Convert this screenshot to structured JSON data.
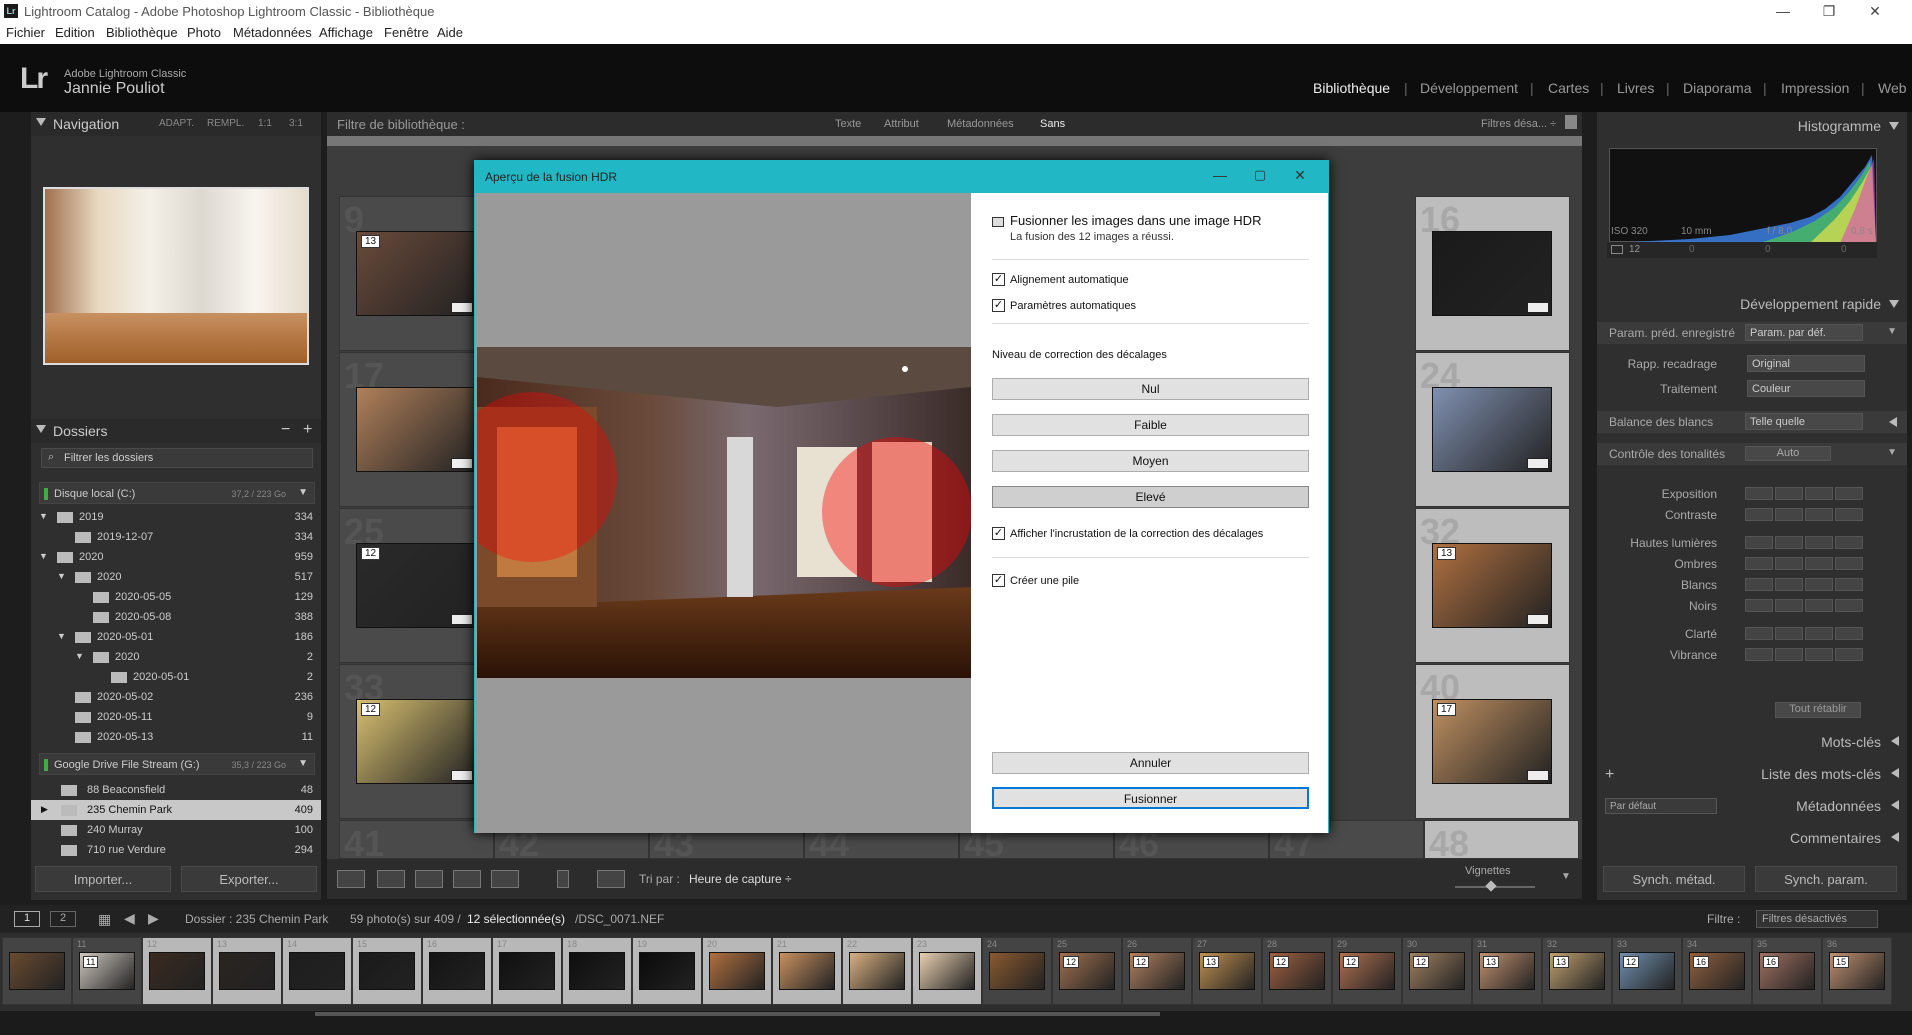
{
  "window": {
    "title": "Lightroom Catalog - Adobe Photoshop Lightroom Classic - Bibliothèque",
    "minimize": "—",
    "restore": "❐",
    "close": "✕",
    "app_icon": "Lr"
  },
  "menu": [
    "Fichier",
    "Edition",
    "Bibliothèque",
    "Photo",
    "Métadonnées",
    "Affichage",
    "Fenêtre",
    "Aide"
  ],
  "identity": {
    "logo": "Lr",
    "app": "Adobe Lightroom Classic",
    "user": "Jannie Pouliot"
  },
  "modules": [
    {
      "label": "Bibliothèque",
      "active": true
    },
    {
      "label": "Développement"
    },
    {
      "label": "Cartes"
    },
    {
      "label": "Livres"
    },
    {
      "label": "Diaporama"
    },
    {
      "label": "Impression"
    },
    {
      "label": "Web"
    }
  ],
  "module_sep": "|",
  "navigator": {
    "title": "Navigation",
    "zoom": [
      "ADAPT.",
      "REMPL.",
      "1:1",
      "3:1"
    ]
  },
  "folders": {
    "title": "Dossiers",
    "minus": "−",
    "plus": "+",
    "filter_placeholder": "Filtrer les dossiers",
    "volumes": [
      {
        "name": "Disque local (C:)",
        "size": "37,2 / 223 Go"
      },
      {
        "name": "Google Drive File Stream (G:)",
        "size": "35,3 / 223 Go"
      }
    ],
    "tree": [
      {
        "name": "2019",
        "count": "334",
        "level": 0,
        "expanded": true
      },
      {
        "name": "2019-12-07",
        "count": "334",
        "level": 1
      },
      {
        "name": "2020",
        "count": "959",
        "level": 0,
        "expanded": true
      },
      {
        "name": "2020",
        "count": "517",
        "level": 1,
        "expanded": true
      },
      {
        "name": "2020-05-05",
        "count": "129",
        "level": 2
      },
      {
        "name": "2020-05-08",
        "count": "388",
        "level": 2
      },
      {
        "name": "2020-05-01",
        "count": "186",
        "level": 1,
        "expanded": true
      },
      {
        "name": "2020",
        "count": "2",
        "level": 2,
        "expanded": true
      },
      {
        "name": "2020-05-01",
        "count": "2",
        "level": 3
      },
      {
        "name": "2020-05-02",
        "count": "236",
        "level": 1
      },
      {
        "name": "2020-05-11",
        "count": "9",
        "level": 1
      },
      {
        "name": "2020-05-13",
        "count": "11",
        "level": 1
      }
    ],
    "gdrive": [
      {
        "name": "88 Beaconsfield",
        "count": "48"
      },
      {
        "name": "235 Chemin Park",
        "count": "409",
        "selected": true
      },
      {
        "name": "240 Murray",
        "count": "100"
      },
      {
        "name": "710 rue Verdure",
        "count": "294"
      }
    ]
  },
  "left_buttons": {
    "import": "Importer...",
    "export": "Exporter..."
  },
  "library_filter": {
    "title": "Filtre de bibliothèque :",
    "tabs": [
      "Texte",
      "Attribut",
      "Métadonnées",
      "Sans"
    ],
    "preset": "Filtres désa... ÷"
  },
  "grid": {
    "cells": [
      {
        "num": "9",
        "badge": "13",
        "row": 0,
        "col": 0
      },
      {
        "num": "16",
        "badge": "",
        "row": 0,
        "col": 7
      },
      {
        "num": "17",
        "badge": "",
        "row": 1,
        "col": 0
      },
      {
        "num": "24",
        "badge": "",
        "row": 1,
        "col": 7
      },
      {
        "num": "25",
        "badge": "12",
        "row": 2,
        "col": 0
      },
      {
        "num": "32",
        "badge": "13",
        "row": 2,
        "col": 7
      },
      {
        "num": "33",
        "badge": "12",
        "row": 3,
        "col": 0
      },
      {
        "num": "40",
        "badge": "17",
        "row": 3,
        "col": 7
      }
    ],
    "bottom_row": [
      "41",
      "42",
      "43",
      "44",
      "45",
      "46",
      "47",
      "48"
    ]
  },
  "toolbar": {
    "sort_label": "Tri par :",
    "sort_value": "Heure de capture ÷",
    "thumbs_label": "Vignettes"
  },
  "histogram": {
    "title": "Histogramme",
    "iso": "ISO 320",
    "focal": "10 mm",
    "aperture": "f / 8,0",
    "shutter": "0,8 s",
    "count": "12",
    "stat_zero": "0"
  },
  "quick_develop": {
    "title": "Développement rapide",
    "preset_label": "Param. préd. enregistré",
    "preset_value": "Param. par déf.",
    "crop_label": "Rapp. recadrage",
    "crop_value": "Original",
    "treatment_label": "Traitement",
    "treatment_value": "Couleur",
    "wb_label": "Balance des blancs",
    "wb_value": "Telle quelle",
    "tone_label": "Contrôle des tonalités",
    "tone_auto": "Auto",
    "sliders": [
      "Exposition",
      "Contraste",
      "Hautes lumières",
      "Ombres",
      "Blancs",
      "Noirs",
      "Clarté",
      "Vibrance"
    ],
    "reset": "Tout rétablir"
  },
  "right_panels": {
    "keywords": "Mots-clés",
    "keyword_list": "Liste des mots-clés",
    "metadata": "Métadonnées",
    "metadata_preset": "Par défaut",
    "comments": "Commentaires"
  },
  "right_buttons": {
    "sync_meta": "Synch. métad.",
    "sync_param": "Synch. param."
  },
  "filmstrip_bar": {
    "page1": "1",
    "page2": "2",
    "path_label": "Dossier : 235 Chemin Park",
    "count": "59 photo(s) sur 409 /",
    "selected": "12 sélectionnée(s)",
    "file": "/DSC_0071.NEF",
    "filter_label": "Filtre :",
    "filter_value": "Filtres désactivés"
  },
  "filmstrip": [
    {
      "n": "",
      "b": ""
    },
    {
      "n": "11",
      "b": "11"
    },
    {
      "n": "12",
      "b": "",
      "sel": true
    },
    {
      "n": "13",
      "b": "",
      "sel": true
    },
    {
      "n": "14",
      "b": "",
      "sel": true
    },
    {
      "n": "15",
      "b": "",
      "sel": true
    },
    {
      "n": "16",
      "b": "",
      "sel": true
    },
    {
      "n": "17",
      "b": "",
      "sel": true
    },
    {
      "n": "18",
      "b": "",
      "sel": true
    },
    {
      "n": "19",
      "b": "",
      "sel": true
    },
    {
      "n": "20",
      "b": "",
      "sel": true
    },
    {
      "n": "21",
      "b": "",
      "sel": true
    },
    {
      "n": "22",
      "b": "",
      "sel": true
    },
    {
      "n": "23",
      "b": "",
      "sel": true
    },
    {
      "n": "24",
      "b": ""
    },
    {
      "n": "25",
      "b": "12"
    },
    {
      "n": "26",
      "b": "12"
    },
    {
      "n": "27",
      "b": "13"
    },
    {
      "n": "28",
      "b": "12"
    },
    {
      "n": "29",
      "b": "12"
    },
    {
      "n": "30",
      "b": "12"
    },
    {
      "n": "31",
      "b": "13"
    },
    {
      "n": "32",
      "b": "13"
    },
    {
      "n": "33",
      "b": "12"
    },
    {
      "n": "34",
      "b": "16"
    },
    {
      "n": "35",
      "b": "16"
    },
    {
      "n": "36",
      "b": "15"
    }
  ],
  "dialog": {
    "title": "Aperçu de la fusion HDR",
    "heading": "Fusionner les images dans une image HDR",
    "status": "La fusion des 12 images a réussi.",
    "auto_align": "Alignement automatique",
    "auto_settings": "Paramètres automatiques",
    "deghost_label": "Niveau de correction des décalages",
    "levels": [
      "Nul",
      "Faible",
      "Moyen",
      "Elevé"
    ],
    "selected_level": "Elevé",
    "overlay": "Afficher l'incrustation de la correction des décalages",
    "stack": "Créer une pile",
    "check": "✓",
    "cancel": "Annuler",
    "merge": "Fusionner"
  },
  "colors": {
    "dialog_accent": "#21b7c4",
    "default_button": "#0078d7",
    "ghost_overlay": "#ff0000"
  }
}
